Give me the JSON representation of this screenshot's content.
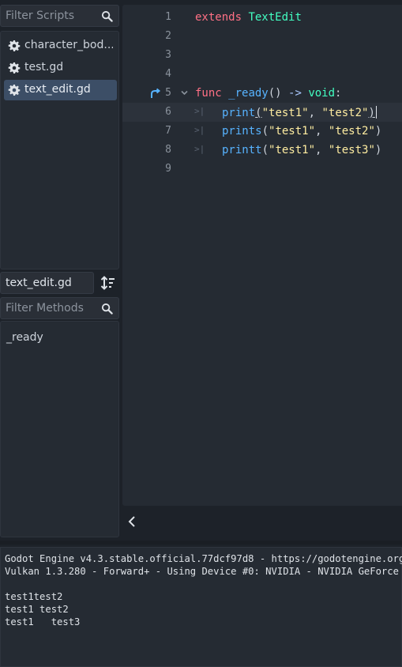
{
  "scripts_panel": {
    "filter_placeholder": "Filter Scripts",
    "items": [
      {
        "label": "character_bod..."
      },
      {
        "label": "test.gd"
      },
      {
        "label": "text_edit.gd"
      }
    ],
    "current_file": "text_edit.gd",
    "methods_filter_placeholder": "Filter Methods",
    "methods": [
      "_ready"
    ]
  },
  "editor": {
    "line_numbers": [
      "1",
      "2",
      "3",
      "4",
      "5",
      "6",
      "7",
      "8",
      "9"
    ],
    "current_line": 6,
    "lines": {
      "l1": {
        "kw": "extends",
        "cls": "TextEdit"
      },
      "l5": {
        "kw": "func",
        "fn": "_ready",
        "paren": "()",
        "arrow": "->",
        "ty": "void",
        "colon": ":"
      },
      "l6": {
        "fn": "print",
        "open": "(",
        "s1": "\"test1\"",
        "comma": ", ",
        "s2": "\"test2\"",
        "close": ")"
      },
      "l7": {
        "fn": "prints",
        "open": "(",
        "s1": "\"test1\"",
        "comma": ", ",
        "s2": "\"test2\"",
        "close": ")"
      },
      "l8": {
        "fn": "printt",
        "open": "(",
        "s1": "\"test1\"",
        "comma": ", ",
        "s2": "\"test3\"",
        "close": ")"
      }
    }
  },
  "output": {
    "lines": [
      "Godot Engine v4.3.stable.official.77dcf97d8 - https://godotengine.org",
      "Vulkan 1.3.280 - Forward+ - Using Device #0: NVIDIA - NVIDIA GeForce",
      "",
      "test1test2",
      "test1 test2",
      "test1   test3"
    ]
  },
  "colors": {
    "keyword": "#ff7085",
    "class": "#42ffc2",
    "function": "#57b3ff",
    "string": "#ffeda1",
    "selection": "#3c4e66"
  },
  "icons": {
    "search": "search-icon",
    "script": "gear-icon",
    "sort": "sort-icon",
    "override": "override-icon",
    "fold": "chevron-down-icon",
    "collapse": "chevron-left-icon"
  }
}
